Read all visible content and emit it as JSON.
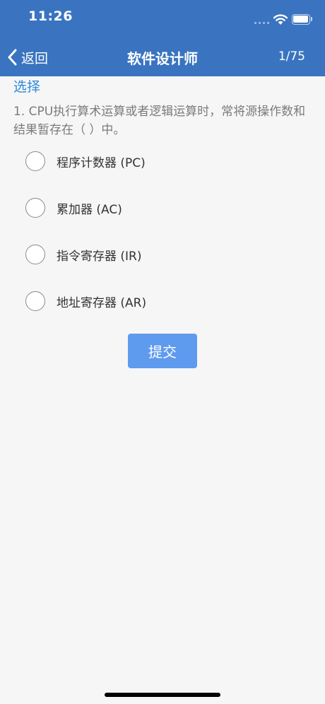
{
  "status_bar": {
    "time": "11:26"
  },
  "nav": {
    "back_label": "返回",
    "title": "软件设计师",
    "page_counter": "1/75"
  },
  "section": {
    "label": "选择"
  },
  "question": {
    "text": "1. CPU执行算术运算或者逻辑运算时，常将源操作数和结果暂存在（ ）中。"
  },
  "options": [
    {
      "label": "程序计数器 (PC)",
      "selected": false
    },
    {
      "label": "累加器 (AC)",
      "selected": false
    },
    {
      "label": "指令寄存器 (IR)",
      "selected": false
    },
    {
      "label": "地址寄存器 (AR)",
      "selected": false
    }
  ],
  "submit": {
    "label": "提交"
  },
  "colors": {
    "header_bg": "#3a74c0",
    "accent": "#2f8ad8",
    "button_bg": "#5e9bef",
    "page_bg": "#f6f6f6"
  }
}
